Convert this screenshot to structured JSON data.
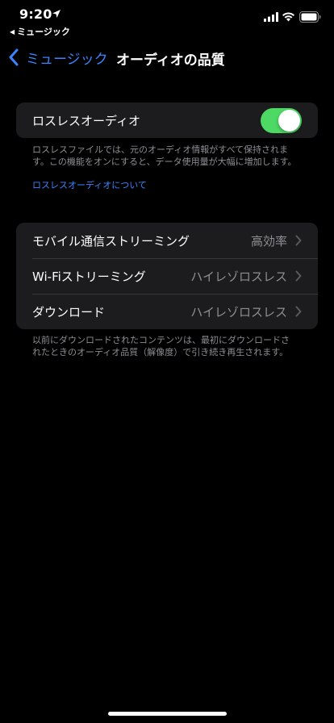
{
  "status_bar": {
    "time": "9:20",
    "back_app": "ミュージック",
    "icons": [
      "location-arrow-icon",
      "cellular-signal-icon",
      "wifi-icon",
      "battery-icon"
    ]
  },
  "nav": {
    "back_label": "ミュージック",
    "title": "オーディオの品質"
  },
  "lossless": {
    "label": "ロスレスオーディオ",
    "toggle_on": true,
    "description_line1": "ロスレスファイルでは、元のオーディオ情報がすべて保持されま",
    "description_line2": "す。この機能をオンにすると、データ使用量が大幅に増加します。",
    "link": "ロスレスオーディオについて"
  },
  "streaming": {
    "rows": [
      {
        "label": "モバイル通信ストリーミング",
        "value": "高効率"
      },
      {
        "label": "Wi-Fiストリーミング",
        "value": "ハイレゾロスレス"
      },
      {
        "label": "ダウンロード",
        "value": "ハイレゾロスレス"
      }
    ],
    "footnote_line1": "以前にダウンロードされたコンテンツは、最初にダウンロードさ",
    "footnote_line2": "れたときのオーディオ品質（解像度）で引き続き再生されます。"
  },
  "colors": {
    "accent": "#3a84ff",
    "toggle_on": "#4cd964",
    "group_bg": "#1c1c1e",
    "secondary_text": "#8e8e93"
  }
}
